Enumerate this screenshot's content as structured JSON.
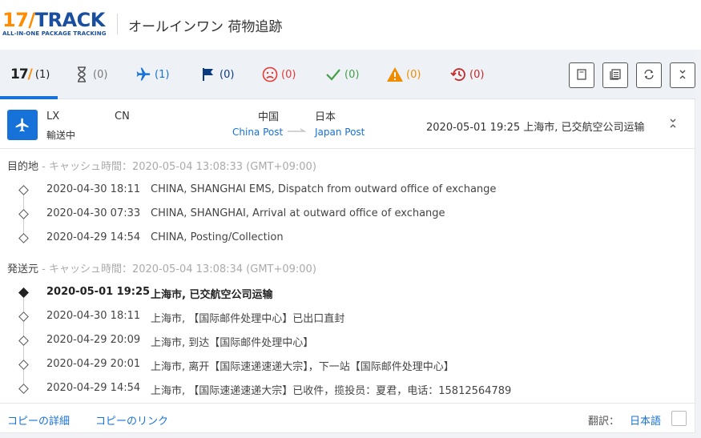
{
  "header": {
    "logo_num": "17",
    "logo_slash": "/",
    "logo_word": "TRACK",
    "logo_tagline": "ALL-IN-ONE PACKAGE TRACKING",
    "title": "オールインワン 荷物追跡"
  },
  "tabs": [
    {
      "icon": "17track-logo-icon",
      "count": "(1)",
      "color": "#222222"
    },
    {
      "icon": "hourglass-icon",
      "count": "(0)",
      "color": "#555555"
    },
    {
      "icon": "airplane-icon",
      "count": "(1)",
      "color": "#1672d8"
    },
    {
      "icon": "flag-icon",
      "count": "(0)",
      "color": "#0a3a80"
    },
    {
      "icon": "sad-face-icon",
      "count": "(0)",
      "color": "#e53935"
    },
    {
      "icon": "checkmark-icon",
      "count": "(0)",
      "color": "#43a047"
    },
    {
      "icon": "warning-icon",
      "count": "(0)",
      "color": "#f08c00"
    },
    {
      "icon": "history-icon",
      "count": "(0)",
      "color": "#c62828"
    }
  ],
  "tab_icon_17": {
    "num": "17",
    "slash": "/"
  },
  "toolbar": {
    "buttons": [
      "copy-icon",
      "copy-list-icon",
      "refresh-icon",
      "collapse-icon"
    ]
  },
  "shipment": {
    "number_prefix": "LX",
    "number_suffix": "CN",
    "status": "輸送中",
    "origin_country": "中国",
    "origin_carrier": "China Post",
    "dest_country": "日本",
    "dest_carrier": "Japan Post",
    "latest_event": "2020-05-01 19:25  上海市, 已交航空公司运输"
  },
  "destination_section": {
    "name": "目的地",
    "cache": " - キャッシュ時間：2020-05-04 13:08:33 (GMT+09:00)",
    "events": [
      {
        "time": "2020-04-30 18:11",
        "desc": "CHINA, SHANGHAI EMS, Dispatch from outward office of exchange"
      },
      {
        "time": "2020-04-30 07:33",
        "desc": "CHINA, SHANGHAI, Arrival at outward office of exchange"
      },
      {
        "time": "2020-04-29 14:54",
        "desc": "CHINA, Posting/Collection"
      }
    ]
  },
  "origin_section": {
    "name": "発送元",
    "cache": " - キャッシュ時間：2020-05-04 13:08:34 (GMT+09:00)",
    "events": [
      {
        "time": "2020-05-01 19:25",
        "desc": "上海市, 已交航空公司运输"
      },
      {
        "time": "2020-04-30 18:11",
        "desc": "上海市, 【国际邮件处理中心】已出口直封"
      },
      {
        "time": "2020-04-29 20:09",
        "desc": "上海市, 到达【国际邮件处理中心】"
      },
      {
        "time": "2020-04-29 20:01",
        "desc": "上海市, 离开【国际速递速递大宗】，下一站【国际邮件处理中心】"
      },
      {
        "time": "2020-04-29 14:54",
        "desc": "上海市, 【国际速递速递大宗】已收件，揽投员：夏君，电话：15812564789"
      }
    ]
  },
  "footer": {
    "copy_details": "コピーの詳細",
    "copy_link": "コピーのリンク",
    "translate_label": "翻訳：",
    "language": "日本語"
  }
}
